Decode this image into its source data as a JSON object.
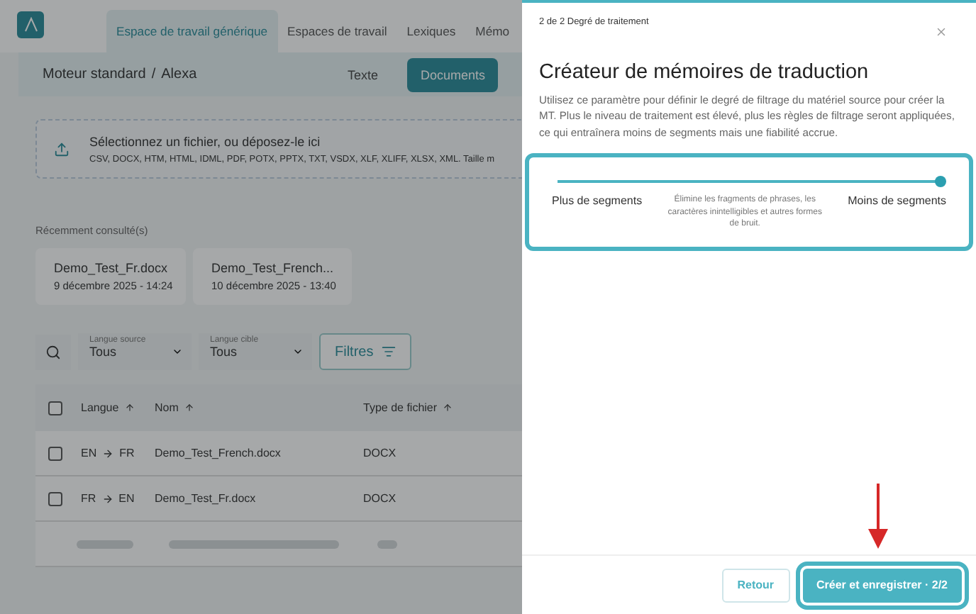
{
  "nav": {
    "tabs": [
      {
        "label": "Espace de travail générique",
        "selected": true
      },
      {
        "label": "Espaces de travail",
        "selected": false
      },
      {
        "label": "Lexiques",
        "selected": false
      },
      {
        "label": "Mémo",
        "selected": false
      }
    ]
  },
  "subheader": {
    "breadcrumb": [
      "Moteur standard",
      "Alexa"
    ],
    "separator": "/",
    "modes": [
      {
        "label": "Texte",
        "selected": false
      },
      {
        "label": "Documents",
        "selected": true
      }
    ]
  },
  "upload": {
    "title": "Sélectionnez un fichier, ou déposez-le ici",
    "formats": "CSV, DOCX, HTM, HTML, IDML, PDF, POTX, PPTX, TXT, VSDX, XLF, XLIFF, XLSX, XML. Taille m"
  },
  "recent": {
    "heading": "Récemment consulté(s)",
    "items": [
      {
        "name": "Demo_Test_Fr.docx",
        "date": "9 décembre 2025 - 14:24"
      },
      {
        "name": "Demo_Test_French...",
        "date": "10 décembre 2025 - 13:40"
      }
    ]
  },
  "filters": {
    "source": {
      "label": "Langue source",
      "value": "Tous"
    },
    "target": {
      "label": "Langue cible",
      "value": "Tous"
    },
    "button": "Filtres"
  },
  "table": {
    "columns": [
      "Langue",
      "Nom",
      "Type de fichier"
    ],
    "all_checked": false,
    "rows": [
      {
        "checked": false,
        "source": "EN",
        "target": "FR",
        "name": "Demo_Test_French.docx",
        "type": "DOCX"
      },
      {
        "checked": false,
        "source": "FR",
        "target": "EN",
        "name": "Demo_Test_Fr.docx",
        "type": "DOCX"
      }
    ],
    "blurred_row": true
  },
  "drawer": {
    "step": "2 de 2 Degré de traitement",
    "title": "Créateur de mémoires de traduction",
    "description": "Utilisez ce paramètre pour définir le degré de filtrage du matériel source pour créer la MT. Plus le niveau de traitement est élevé, plus les règles de filtrage seront appliquées, ce qui entraînera moins de segments mais une fiabilité accrue.",
    "slider": {
      "level": 1,
      "min_label": "Plus de segments",
      "hint": "Élimine les fragments de phrases, les caractères inintelligibles et autres formes de bruit.",
      "max_label": "Moins de segments"
    },
    "buttons": [
      {
        "label": "Retour",
        "kind": "secondary"
      },
      {
        "label": "Créer et enregistrer · 2/2",
        "kind": "primary"
      }
    ]
  }
}
